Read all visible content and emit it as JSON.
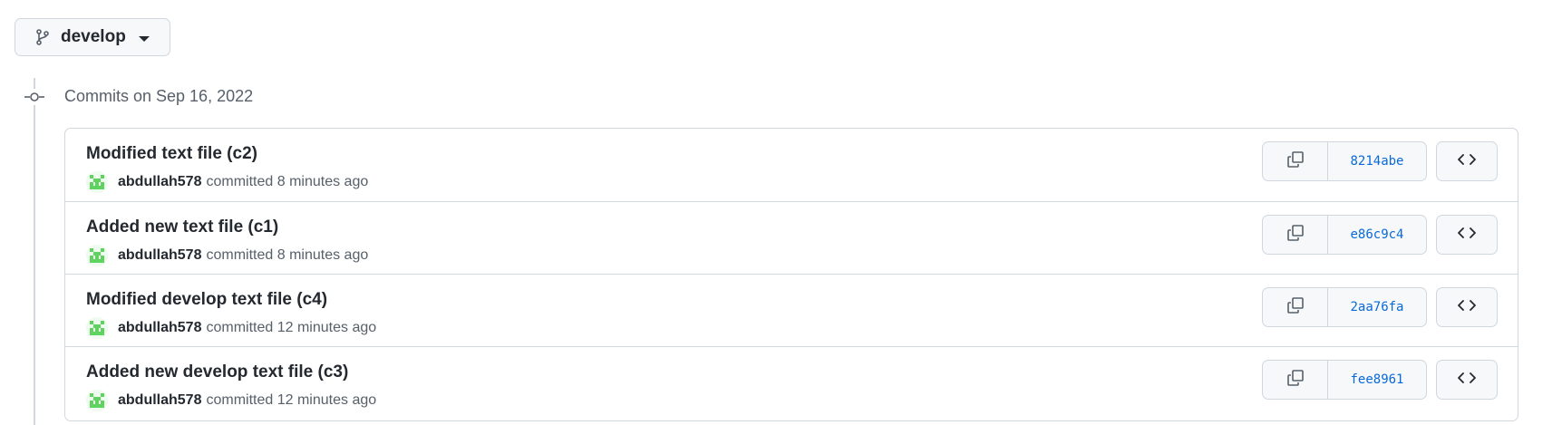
{
  "branch": {
    "name": "develop",
    "icon": "git-branch-icon"
  },
  "commit_group": {
    "heading": "Commits on Sep 16, 2022",
    "icon": "git-commit-icon"
  },
  "colors": {
    "sha_link": "#0969da",
    "avatar_green": "#5fd35f",
    "border": "#d0d7de",
    "muted_text": "#57606a"
  },
  "commits": [
    {
      "title": "Modified text file (c2)",
      "author": "abdullah578",
      "action": "committed",
      "time": "8 minutes ago",
      "sha": "8214abe"
    },
    {
      "title": "Added new text file (c1)",
      "author": "abdullah578",
      "action": "committed",
      "time": "8 minutes ago",
      "sha": "e86c9c4"
    },
    {
      "title": "Modified develop text file (c4)",
      "author": "abdullah578",
      "action": "committed",
      "time": "12 minutes ago",
      "sha": "2aa76fa"
    },
    {
      "title": "Added new develop text file (c3)",
      "author": "abdullah578",
      "action": "committed",
      "time": "12 minutes ago",
      "sha": "fee8961"
    }
  ]
}
